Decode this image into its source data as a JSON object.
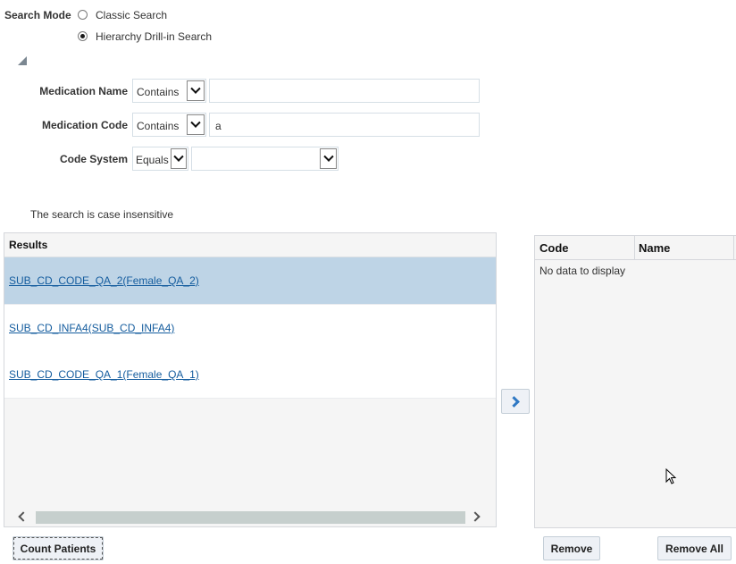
{
  "search_mode": {
    "label": "Search Mode",
    "options": [
      {
        "label": "Classic Search",
        "selected": false
      },
      {
        "label": "Hierarchy Drill-in Search",
        "selected": true
      }
    ]
  },
  "criteria": [
    {
      "label": "Medication Name",
      "operator": "Contains",
      "value": ""
    },
    {
      "label": "Medication Code",
      "operator": "Contains",
      "value": "a"
    },
    {
      "label": "Code System",
      "operator": "Equals",
      "value": ""
    }
  ],
  "note": "The search is case insensitive",
  "results": {
    "header": "Results",
    "items": [
      {
        "label": "SUB_CD_CODE_QA_2(Female_QA_2)",
        "selected": true
      },
      {
        "label": "SUB_CD_INFA4(SUB_CD_INFA4)",
        "selected": false
      },
      {
        "label": "SUB_CD_CODE_QA_1(Female_QA_1)",
        "selected": false
      }
    ]
  },
  "selected_table": {
    "columns": [
      "Code",
      "Name"
    ],
    "empty_text": "No data to display"
  },
  "buttons": {
    "move_right": "move-right",
    "count_patients": "Count Patients",
    "remove": "Remove",
    "remove_all": "Remove All"
  },
  "colors": {
    "selected_row": "#bed4e6",
    "link": "#145c9e",
    "panel_bg": "#f5f5f5"
  }
}
